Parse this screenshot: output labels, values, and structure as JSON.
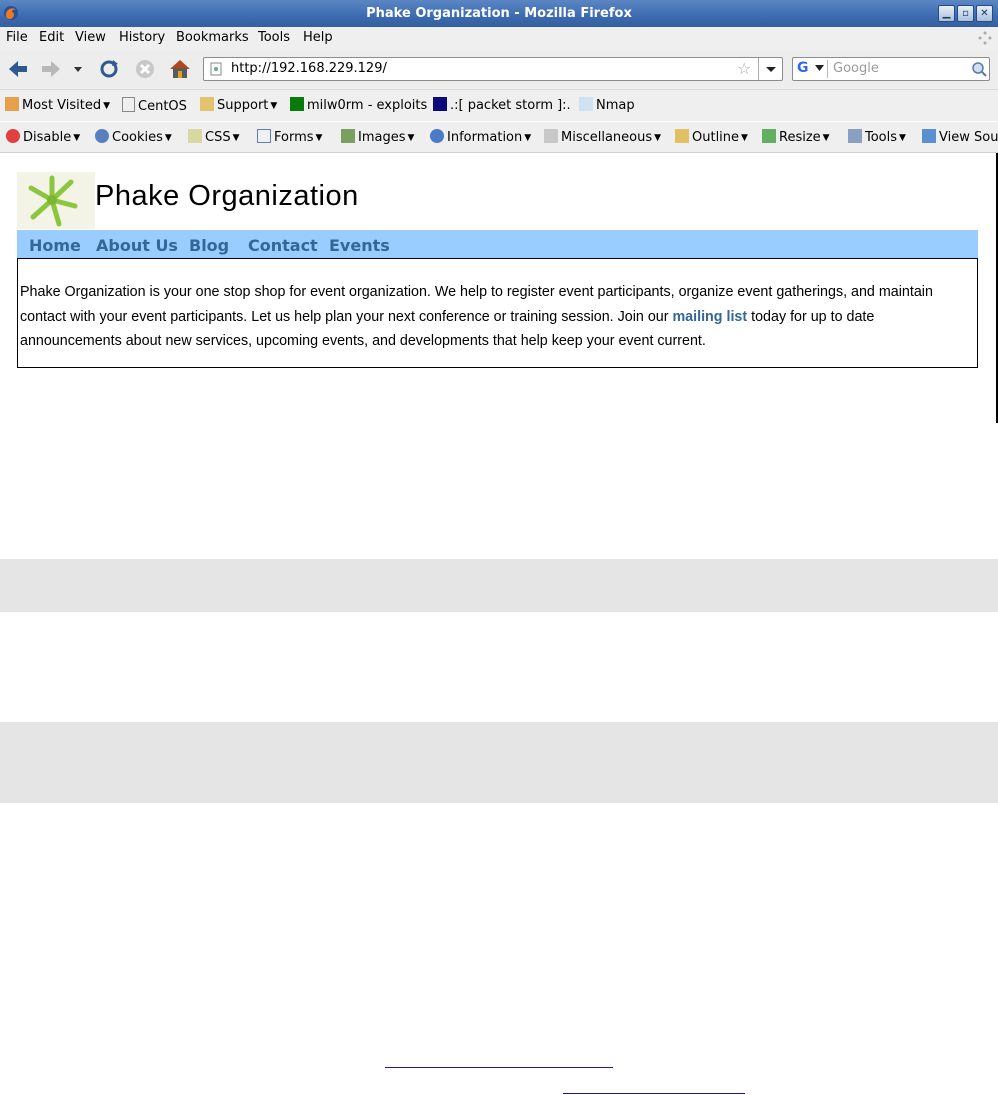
{
  "window": {
    "title": "Phake Organization - Mozilla Firefox"
  },
  "menubar": {
    "items": [
      "File",
      "Edit",
      "View",
      "History",
      "Bookmarks",
      "Tools",
      "Help"
    ]
  },
  "navbar": {
    "url": "http://192.168.229.129/",
    "search_placeholder": "Google"
  },
  "bookmarks": {
    "items": [
      "Most Visited",
      "CentOS",
      "Support",
      "milw0rm - exploits",
      ".:[ packet storm ]:.",
      "Nmap"
    ]
  },
  "devbar": {
    "items": [
      "Disable",
      "Cookies",
      "CSS",
      "Forms",
      "Images",
      "Information",
      "Miscellaneous",
      "Outline",
      "Resize",
      "Tools",
      "View Sou"
    ]
  },
  "page": {
    "site_title": "Phake Organization",
    "nav": [
      "Home",
      "About Us",
      "Blog",
      "Contact",
      "Events"
    ],
    "content_before": "Phake Organization is your one stop shop for event organization. We help to register event participants, organize event gatherings, and maintain contact with your event participants. Let us help plan your next conference or training session. Join our ",
    "content_link": "mailing list",
    "content_after": " today for up to date announcements about new services, upcoming events, and developments that help keep your event current."
  },
  "colors": {
    "titlebar": "#3d6bb0",
    "nav_bg": "#99ccff",
    "nav_link": "#336699",
    "band": "#e5e5e5"
  }
}
